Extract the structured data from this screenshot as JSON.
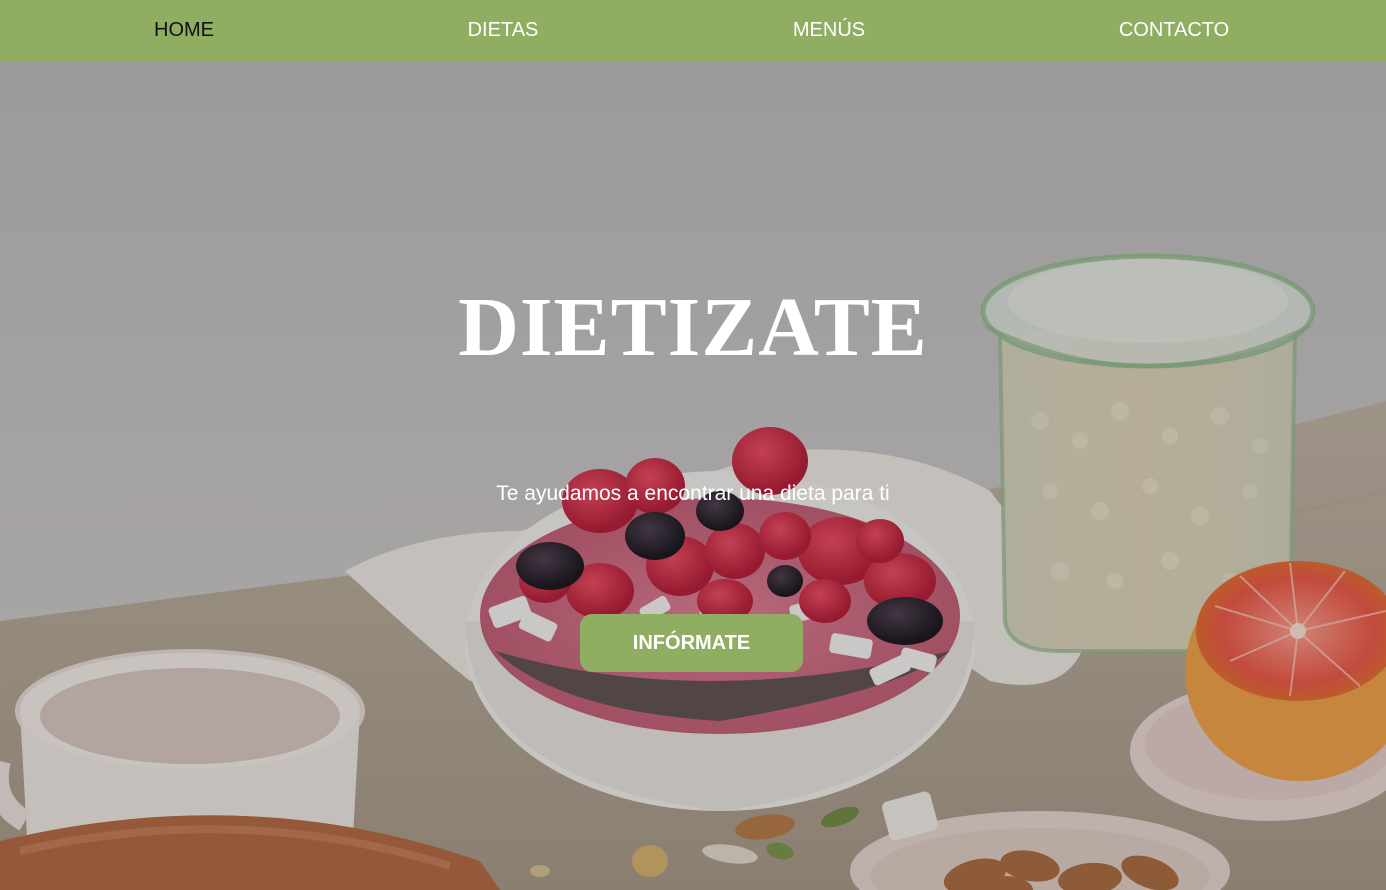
{
  "nav": {
    "items": [
      {
        "label": "HOME",
        "active": true
      },
      {
        "label": "DIETAS",
        "active": false
      },
      {
        "label": "MENÚS",
        "active": false
      },
      {
        "label": "CONTACTO",
        "active": false
      }
    ]
  },
  "hero": {
    "title": "DIETIZATE",
    "subtitle": "Te ayudamos a encontrar una dieta para ti",
    "cta_label": "INFÓRMATE"
  },
  "colors": {
    "accent": "#8fae62",
    "nav_text": "#ffffff",
    "nav_active_text": "#111111"
  }
}
